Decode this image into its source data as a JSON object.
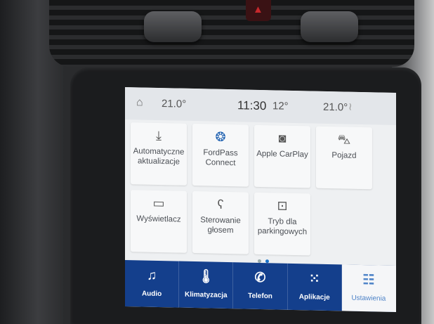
{
  "status_bar": {
    "left_temp": "21.0°",
    "clock": "11:30",
    "outside_temp": "12°",
    "right_temp": "21.0°"
  },
  "tiles": [
    {
      "icon": "download-icon",
      "label": "Automatyczne aktualizacje"
    },
    {
      "icon": "fordpass-logo-icon",
      "label": "FordPass Connect"
    },
    {
      "icon": "carplay-icon",
      "label": "Apple CarPlay"
    },
    {
      "icon": "car-icon",
      "label": "Pojazd"
    },
    {
      "icon": "display-icon",
      "label": "Wyświetlacz"
    },
    {
      "icon": "voice-icon",
      "label": "Sterowanie głosem"
    },
    {
      "icon": "valet-lock-icon",
      "label": "Tryb dla parkingowych"
    }
  ],
  "pagination": {
    "pages": 2,
    "current": 2
  },
  "nav": [
    {
      "icon": "music-note-icon",
      "label": "Audio"
    },
    {
      "icon": "thermometer-icon",
      "label": "Klimatyzacja"
    },
    {
      "icon": "phone-icon",
      "label": "Telefon"
    },
    {
      "icon": "apps-grid-icon",
      "label": "Aplikacje"
    },
    {
      "icon": "settings-sliders-icon",
      "label": "Ustawienia",
      "active": true
    }
  ],
  "colors": {
    "nav_bar": "#143f8c",
    "active_accent": "#4f84c8",
    "hazard": "#c8282c"
  }
}
